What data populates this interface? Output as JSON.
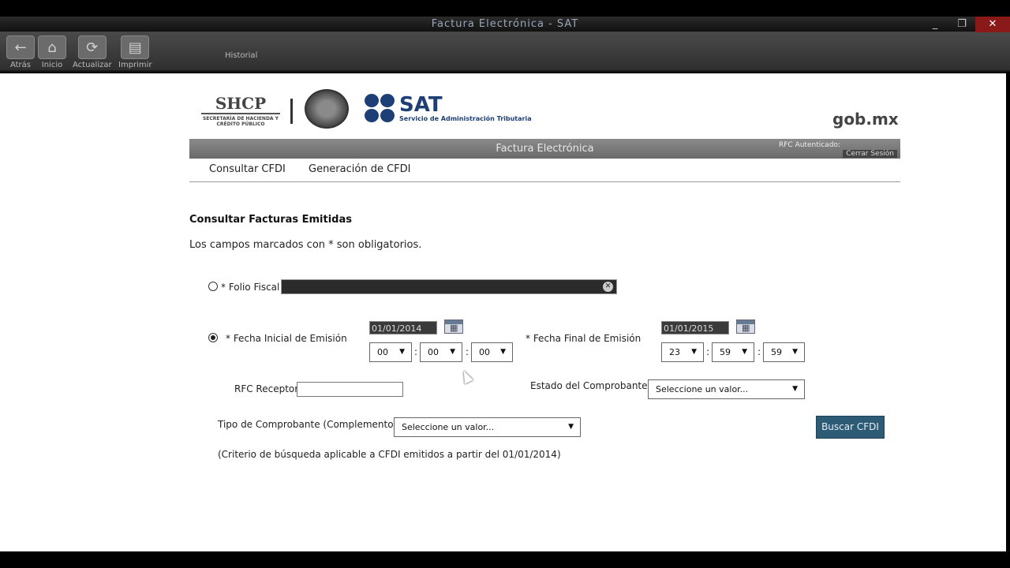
{
  "window": {
    "title": "Factura Electrónica - SAT",
    "controls": [
      "_",
      "❐",
      "✕"
    ]
  },
  "toolbar": {
    "buttons": [
      {
        "label": "Atrás",
        "icon": "back-arrow-icon"
      },
      {
        "label": "Inicio",
        "icon": "home-icon"
      },
      {
        "label": "Actualizar",
        "icon": "refresh-icon"
      },
      {
        "label": "Imprimir",
        "icon": "print-icon"
      }
    ],
    "extra_label": "Historial"
  },
  "header": {
    "shcp": "SHCP",
    "shcp_sub": "SECRETARÍA DE HACIENDA Y CRÉDITO PÚBLICO",
    "sat": "SAT",
    "sat_sub": "Servicio de Administración Tributaria",
    "gob": "gob.mx"
  },
  "banner": {
    "title": "Factura Electrónica",
    "rfc_label": "RFC Autenticado:",
    "logout": "Cerrar Sesión"
  },
  "nav": {
    "items": [
      "Consultar CFDI",
      "Generación de CFDI"
    ]
  },
  "form": {
    "title": "Consultar Facturas Emitidas",
    "required_note": "Los campos marcados con * son obligatorios.",
    "folio_label": "* Folio Fiscal",
    "fecha_inicial_label": "* Fecha Inicial de Emisión",
    "fecha_inicial_value": "01/01/2014",
    "hora_inicial": [
      "00",
      "00",
      "00"
    ],
    "fecha_final_label": "* Fecha Final de Emisión",
    "fecha_final_value": "01/01/2015",
    "hora_final": [
      "23",
      "59",
      "59"
    ],
    "rfc_receptor_label": "RFC Receptor",
    "estado_label": "Estado del Comprobante",
    "estado_value": "Seleccione un valor...",
    "tipo_label": "Tipo de Comprobante (Complemento)",
    "tipo_value": "Seleccione un valor...",
    "buscar_label": "Buscar CFDI",
    "criteria_note": "(Criterio de búsqueda aplicable a CFDI emitidos a partir del 01/01/2014)"
  },
  "colors": {
    "sat_blue": "#1d3f75",
    "button": "#2d5b75",
    "banner": "#7a7a7a"
  }
}
